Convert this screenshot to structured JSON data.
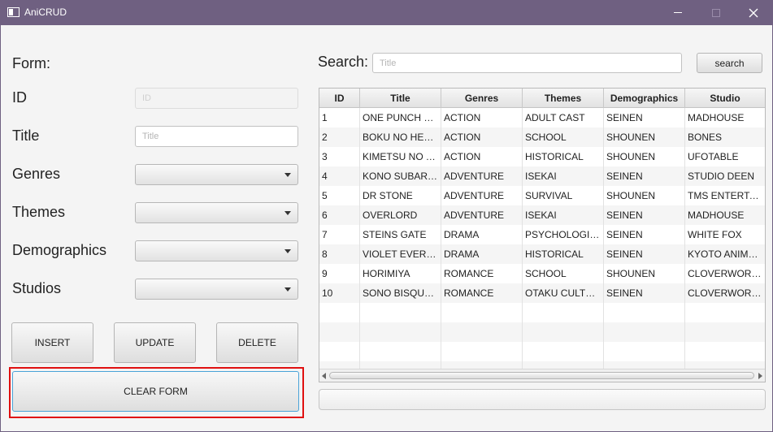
{
  "window": {
    "title": "AniCRUD"
  },
  "form": {
    "heading": "Form:",
    "id_label": "ID",
    "id_placeholder": "ID",
    "title_label": "Title",
    "title_placeholder": "Title",
    "genres_label": "Genres",
    "themes_label": "Themes",
    "demographics_label": "Demographics",
    "studios_label": "Studios"
  },
  "buttons": {
    "insert": "INSERT",
    "update": "UPDATE",
    "delete": "DELETE",
    "clear": "CLEAR FORM",
    "search": "search"
  },
  "search": {
    "label": "Search:",
    "placeholder": "Title"
  },
  "table": {
    "columns": [
      "ID",
      "Title",
      "Genres",
      "Themes",
      "Demographics",
      "Studio"
    ],
    "rows": [
      [
        "1",
        "ONE PUNCH M...",
        "ACTION",
        "ADULT CAST",
        "SEINEN",
        "MADHOUSE"
      ],
      [
        "2",
        "BOKU NO HER...",
        "ACTION",
        "SCHOOL",
        "SHOUNEN",
        "BONES"
      ],
      [
        "3",
        "KIMETSU NO Y...",
        "ACTION",
        "HISTORICAL",
        "SHOUNEN",
        "UFOTABLE"
      ],
      [
        "4",
        "KONO SUBARA...",
        "ADVENTURE",
        "ISEKAI",
        "SEINEN",
        "STUDIO DEEN"
      ],
      [
        "5",
        "DR STONE",
        "ADVENTURE",
        "SURVIVAL",
        "SHOUNEN",
        "TMS ENTERTAI..."
      ],
      [
        "6",
        "OVERLORD",
        "ADVENTURE",
        "ISEKAI",
        "SEINEN",
        "MADHOUSE"
      ],
      [
        "7",
        "STEINS GATE",
        "DRAMA",
        "PSYCHOLOGICAL",
        "SEINEN",
        "WHITE FOX"
      ],
      [
        "8",
        "VIOLET EVERGA...",
        "DRAMA",
        "HISTORICAL",
        "SEINEN",
        "KYOTO ANIMA..."
      ],
      [
        "9",
        "HORIMIYA",
        "ROMANCE",
        "SCHOOL",
        "SHOUNEN",
        "CLOVERWORKS"
      ],
      [
        "10",
        "SONO BISQUE ...",
        "ROMANCE",
        "OTAKU CULTURE",
        "SEINEN",
        "CLOVERWORKS"
      ],
      [
        "",
        "",
        "",
        "",
        "",
        ""
      ],
      [
        "",
        "",
        "",
        "",
        "",
        ""
      ],
      [
        "",
        "",
        "",
        "",
        "",
        ""
      ],
      [
        "",
        "",
        "",
        "",
        "",
        ""
      ]
    ]
  },
  "colors": {
    "titlebar": "#6f6081",
    "background": "#f4f4f4",
    "highlight_outline": "#e01010",
    "focus_border": "#4aa3d8"
  }
}
